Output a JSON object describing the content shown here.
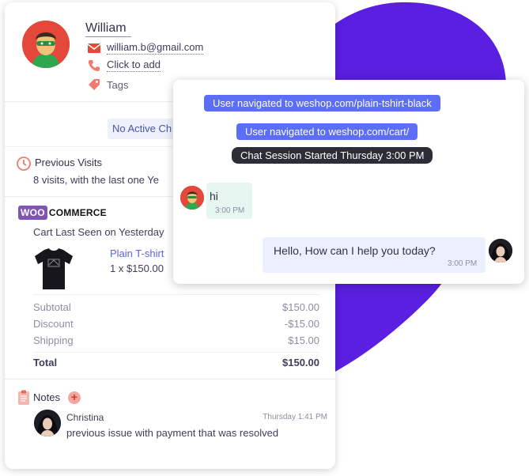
{
  "contact": {
    "name": "William",
    "email": "william.b@gmail.com",
    "phone": "Click to add",
    "tags": "Tags"
  },
  "session_status": "No Active Ch",
  "previous_visits": {
    "title": "Previous Visits",
    "text": "8 visits, with the last one Ye"
  },
  "woocommerce": {
    "logo_badge": "WOO",
    "logo_text": "COMMERCE",
    "cart_seen": "Cart Last Seen on Yesterday",
    "product_name": "Plain T-shirt",
    "product_qty": "1 x $150.00",
    "totals": [
      {
        "label": "Subtotal",
        "value": "$150.00"
      },
      {
        "label": "Discount",
        "value": "-$15.00"
      },
      {
        "label": "Shipping",
        "value": "$15.00"
      }
    ],
    "total": {
      "label": "Total",
      "value": "$150.00"
    }
  },
  "notes": {
    "title": "Notes",
    "add_symbol": "+",
    "items": [
      {
        "author": "Christina",
        "time": "Thursday 1:41 PM",
        "text": "previous issue with payment that was resolved"
      }
    ]
  },
  "chat": {
    "system_messages": [
      "User navigated to weshop.com/plain-tshirt-black",
      "User navigated to weshop.com/cart/",
      "Chat Session Started Thursday 3:00 PM"
    ],
    "incoming": {
      "text": "hi",
      "time": "3:00 PM"
    },
    "outgoing": {
      "text": "Hello, How can I help you today?",
      "time": "3:00 PM"
    }
  },
  "colors": {
    "accent_blue": "#5b6ef5",
    "blob_purple": "#5a1fe0",
    "woo_purple": "#7f54b3",
    "avatar_red": "#e4483a"
  },
  "icons": {
    "email": "envelope-icon",
    "phone": "phone-icon",
    "tags": "tag-icon",
    "visits": "history-clock-icon",
    "notes": "clipboard-icon",
    "add": "plus-icon"
  }
}
